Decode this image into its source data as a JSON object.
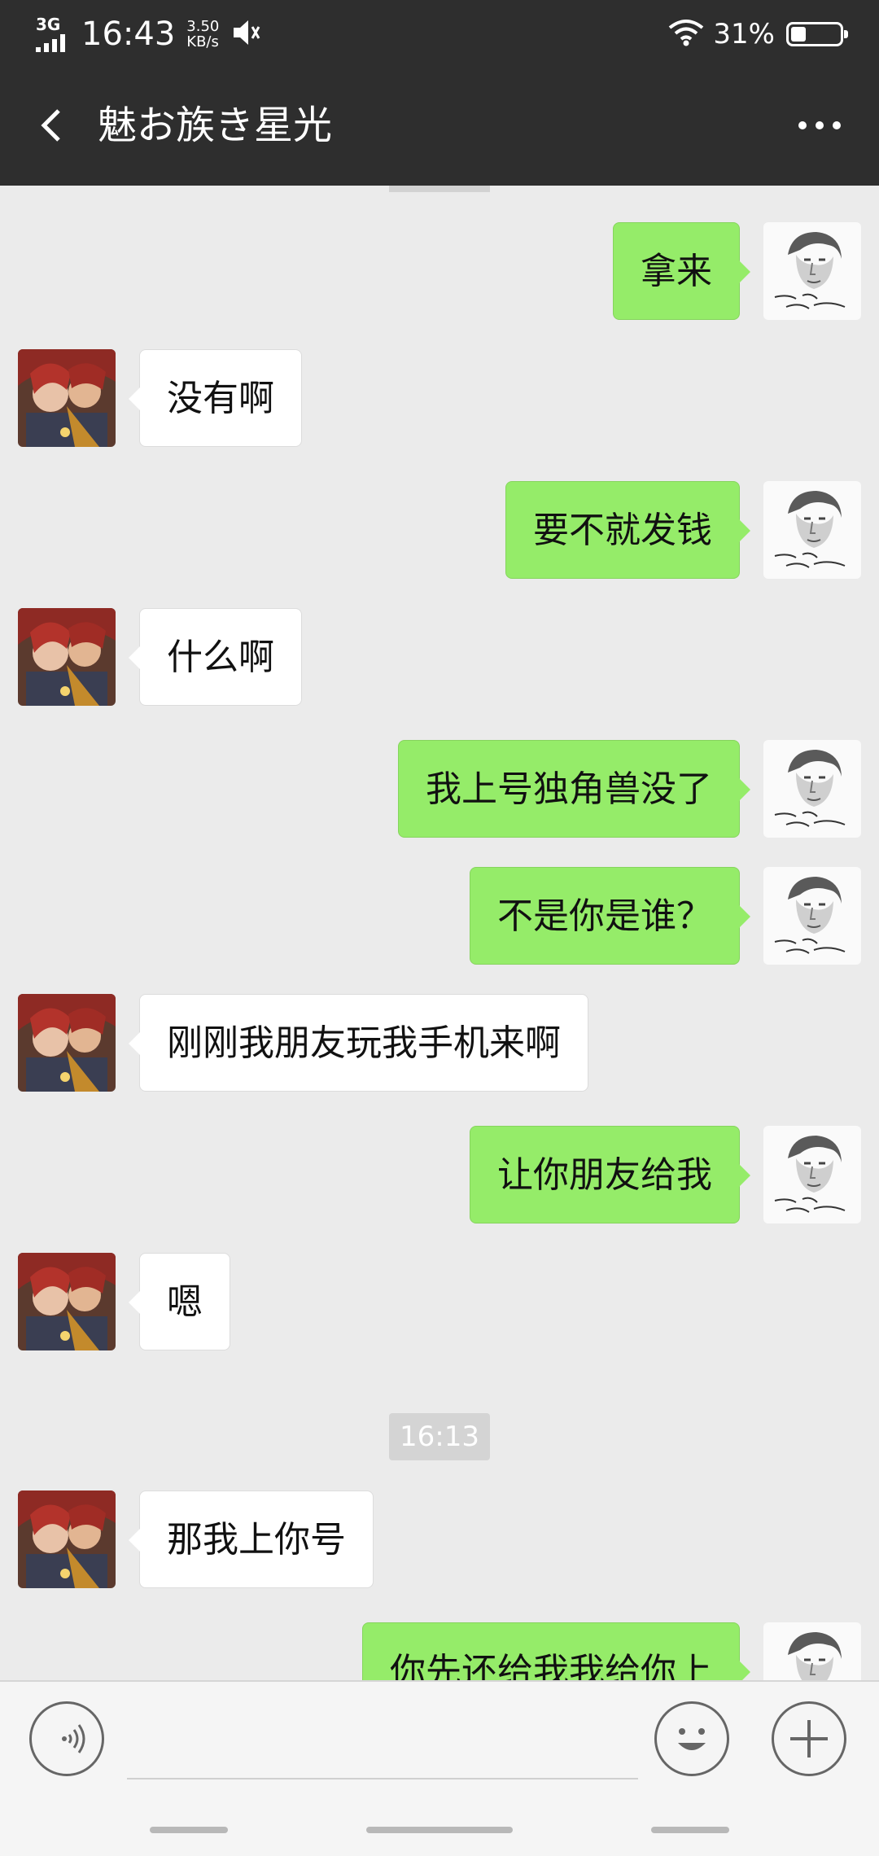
{
  "status_bar": {
    "network": "3G",
    "time": "16:43",
    "speed_value": "3.50",
    "speed_unit": "KB/s",
    "battery": "31%",
    "battery_level": 0.31,
    "icons": [
      "signal-icon",
      "mute-icon",
      "wifi-icon",
      "battery-icon"
    ]
  },
  "header": {
    "title": "魅お族き星光",
    "back_icon": "chevron-left-icon",
    "more_icon": "more-dots-icon"
  },
  "messages": [
    {
      "sender": "me",
      "text": "拿来"
    },
    {
      "sender": "other",
      "text": "没有啊"
    },
    {
      "sender": "me",
      "text": "要不就发钱"
    },
    {
      "sender": "other",
      "text": "什么啊"
    },
    {
      "sender": "me",
      "text": "我上号独角兽没了"
    },
    {
      "sender": "me",
      "text": "不是你是谁？"
    },
    {
      "sender": "other",
      "text": "刚刚我朋友玩我手机来啊"
    },
    {
      "sender": "me",
      "text": "让你朋友给我"
    },
    {
      "sender": "other",
      "text": "嗯"
    },
    {
      "sender": "other",
      "text": "那我上你号"
    },
    {
      "sender": "me",
      "text": "你先还给我我给你上"
    }
  ],
  "timestamp": "16:13",
  "input_bar": {
    "voice_icon": "voice-icon",
    "text_value": "",
    "emoji_icon": "emoji-icon",
    "plus_icon": "plus-icon"
  }
}
